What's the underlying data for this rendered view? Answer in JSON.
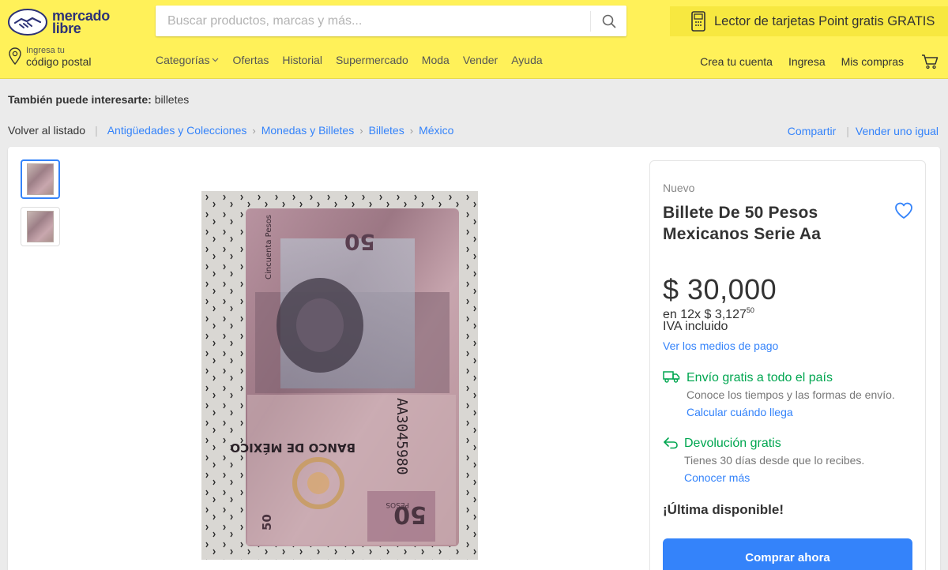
{
  "header": {
    "logo": {
      "line1": "mercado",
      "line2": "libre"
    },
    "search": {
      "placeholder": "Buscar productos, marcas y más..."
    },
    "promo": {
      "text": "Lector de tarjetas Point gratis GRATIS"
    },
    "location": {
      "small": "Ingresa tu",
      "big": "código postal"
    },
    "nav": [
      "Categorías",
      "Ofertas",
      "Historial",
      "Supermercado",
      "Moda",
      "Vender",
      "Ayuda"
    ],
    "user_nav": {
      "create": "Crea tu cuenta",
      "login": "Ingresa",
      "purchases": "Mis compras"
    }
  },
  "also": {
    "label": "También puede interesarte:",
    "value": "billetes"
  },
  "breadcrumb": {
    "back": "Volver al listado",
    "items": [
      "Antigüedades y Colecciones",
      "Monedas y Billetes",
      "Billetes",
      "México"
    ]
  },
  "actions": {
    "share": "Compartir",
    "sell": "Vender uno igual"
  },
  "product": {
    "condition": "Nuevo",
    "title": "Billete De 50 Pesos Mexicanos Serie Aa",
    "price": "$ 30,000",
    "installments": "en 12x $ 3,127",
    "installments_cents": "50",
    "tax": "IVA incluido",
    "payment_link": "Ver los medios de pago",
    "shipping": {
      "title": "Envío gratis a todo el país",
      "desc": "Conoce los tiempos y las formas de envío.",
      "link": "Calcular cuándo llega"
    },
    "returns": {
      "title": "Devolución gratis",
      "desc": "Tienes 30 días desde que lo recibes.",
      "link": "Conocer más"
    },
    "stock": "¡Última disponible!",
    "buy_label": "Comprar ahora"
  },
  "banknote": {
    "serial": "AA3045980",
    "bank": "BANCO DE MÉXICO",
    "denom": "50",
    "words": "Cincuenta Pesos",
    "pesos_label": "PESOS"
  },
  "colors": {
    "header_bg": "#fff159",
    "accent_blue": "#3483fa",
    "green": "#00a650",
    "brand_navy": "#2d3277"
  }
}
